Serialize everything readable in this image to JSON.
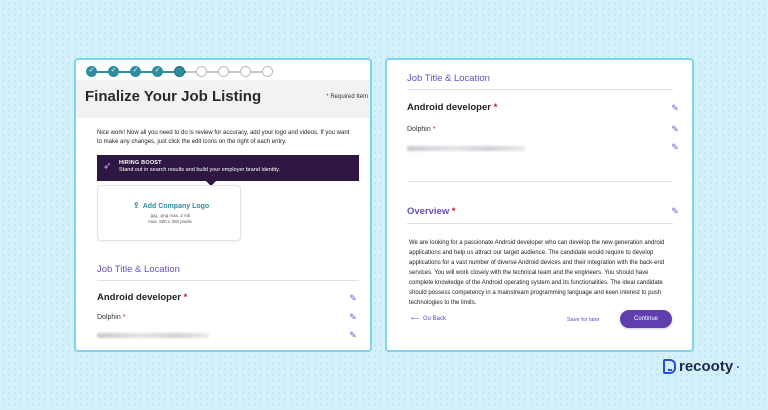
{
  "left_panel": {
    "steps": {
      "completed": 4,
      "current": 5,
      "total": 9
    },
    "title": "Finalize Your Job Listing",
    "required_note": "Required Item",
    "intro": "Nice work! Now all you need to do is review for accuracy, add your logo and videos. If you want to make any changes, just click the edit icons on the right of each entry.",
    "boost_title": "HIRING BOOST",
    "boost_text": "Stand out in search results and build your employer brand identity.",
    "add_logo_label": "Add Company Logo",
    "logo_hint_formats": ".jpg, .png  max. 2 mb",
    "logo_hint_size": "max. 600 x 300 pixels",
    "section_title": "Job Title & Location",
    "job_title": "Android developer",
    "company": "Dolphin"
  },
  "right_panel": {
    "section_title": "Job Title & Location",
    "job_title": "Android developer",
    "company": "Dolphin",
    "overview_title": "Overview",
    "overview_text": "We are looking for a passionate Android developer who can develop the new generation android applications and help us attract our target audience. The candidate would require to develop applications for a vast number of diverse Android devices and their integration with the back-end services. You will work closely with the technical team and the engineers. You should have complete knowledge of the Android operating system and its functionalities. The ideal candidate should possess competency in a mainstream programming language and keen interest to push technologies to the limits.",
    "go_back": "Go Back",
    "save_later": "Save for later",
    "continue": "Continue"
  },
  "brand": {
    "name": "recooty"
  },
  "icons": {
    "edit": "pencil-icon",
    "upload": "cloud-upload-icon",
    "boost": "rocket-icon",
    "back": "arrow-left-icon"
  },
  "colors": {
    "accent": "#6a4dbd",
    "teal": "#2b8f9e",
    "boost_bg": "#2e1742",
    "border": "#7fd3ef"
  }
}
